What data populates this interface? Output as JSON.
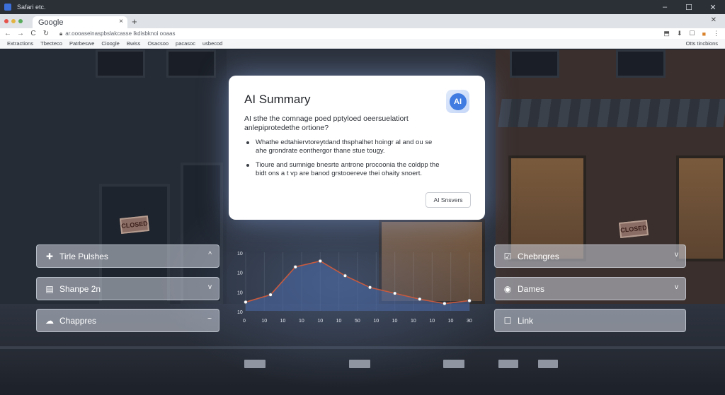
{
  "window": {
    "title": "Safari etc.",
    "controls": [
      "–",
      "☐",
      "✕"
    ]
  },
  "tabs": [
    {
      "label": "Google",
      "active": true
    }
  ],
  "new_tab_label": "+",
  "address_bar": {
    "url": "ar.oooaseinaspbslakcasse lkdisbknoi ooaas"
  },
  "bookmarks": {
    "items": [
      "Extractions",
      "Tbecteco",
      "Patrbeswe",
      "Cioogle",
      "Bwiss",
      "Osacsoo",
      "pacasoc",
      "usbecod"
    ],
    "right_item": "Otts tincbions"
  },
  "ai_summary": {
    "title": "AI Summary",
    "badge": "AI",
    "question": "AI sthe the comnage poed pptyloed oeersuelatiort anlepiprotedethe ortione?",
    "bullets": [
      "Whathe edtahiervtoreytdand thsphalhet hoingr al and ou se ahe grondrate eonthergor thane stue tougy.",
      "Tioure and sumnige bnesrte antrone procoonia the coldpp the bidt ons a t vp are banod grstooereve thei ohaity snoert."
    ],
    "answers_button": "AI Snsvers"
  },
  "left_panels": [
    {
      "label": "Tirle Pulshes",
      "icon": "puzzle-icon",
      "chevron": "^"
    },
    {
      "label": "Shanpe 2n",
      "icon": "document-icon",
      "chevron": "v"
    },
    {
      "label": "Chappres",
      "icon": "cloud-icon",
      "chevron": "~"
    }
  ],
  "right_panels": [
    {
      "label": "Chebngres",
      "icon": "checklist-icon",
      "chevron": "v"
    },
    {
      "label": "Dames",
      "icon": "location-icon",
      "chevron": "v"
    },
    {
      "label": "Link",
      "icon": "link-icon",
      "chevron": ""
    }
  ],
  "chart_data": {
    "type": "line",
    "title": "",
    "xlabel": "",
    "ylabel": "",
    "x_ticks": [
      "0",
      "10",
      "10",
      "10",
      "10",
      "10",
      "50",
      "10",
      "10",
      "10",
      "10",
      "10",
      "30"
    ],
    "y_ticks": [
      "10",
      "10",
      "10",
      "10"
    ],
    "points": [
      6,
      11,
      30,
      34,
      24,
      16,
      12,
      8,
      5,
      7
    ],
    "ylim": [
      0,
      40
    ],
    "fill": true,
    "line_color": "#c85a3e",
    "fill_color": "#4a6aa8"
  },
  "colors": {
    "accent": "#3f7be0",
    "panel_bg": "rgba(205,212,222,0.55)"
  }
}
